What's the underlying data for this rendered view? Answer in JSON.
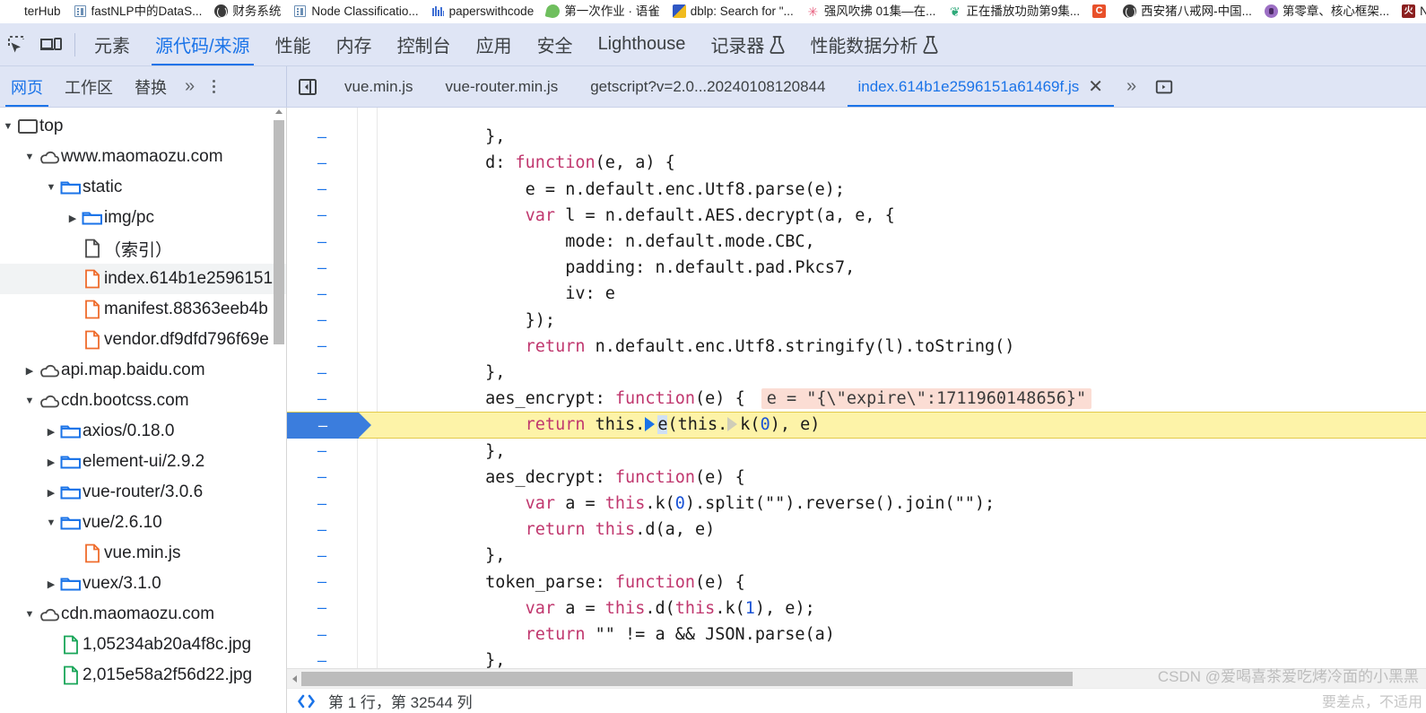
{
  "bookmarks": [
    {
      "label": "terHub",
      "icon": "generic-icon",
      "icon_class": "",
      "glyph": ""
    },
    {
      "label": "fastNLP中的DataS...",
      "icon": "document-icon",
      "icon_class": "fav-doc",
      "glyph": ""
    },
    {
      "label": "财务系统",
      "icon": "globe-icon",
      "icon_class": "fav-globe",
      "glyph": ""
    },
    {
      "label": "Node Classificatio...",
      "icon": "document-icon",
      "icon_class": "fav-doc",
      "glyph": ""
    },
    {
      "label": "paperswithcode",
      "icon": "chart-icon",
      "icon_class": "fav-chart",
      "glyph": ""
    },
    {
      "label": "第一次作业 · 语雀",
      "icon": "yuque-leaf-icon",
      "icon_class": "fav-leaf",
      "glyph": ""
    },
    {
      "label": "dblp: Search for \"...",
      "icon": "dblp-icon",
      "icon_class": "fav-dblp",
      "glyph": ""
    },
    {
      "label": "强风吹拂 01集—在...",
      "icon": "flower-icon",
      "icon_class": "fav-flower",
      "glyph": "✳"
    },
    {
      "label": "正在播放功勋第9集...",
      "icon": "green-video-icon",
      "icon_class": "fav-green-ic",
      "glyph": "❦"
    },
    {
      "label": "",
      "icon": "letter-c-icon",
      "icon_class": "fav-c",
      "glyph": "C"
    },
    {
      "label": "西安猪八戒网-中国...",
      "icon": "globe-icon",
      "icon_class": "fav-zhu",
      "glyph": ""
    },
    {
      "label": "第零章、核心框架...",
      "icon": "purple-circle-icon",
      "icon_class": "fav-purple",
      "glyph": ""
    },
    {
      "label": "Nginx学习 | 何吹",
      "icon": "nginx-icon",
      "icon_class": "fav-nginx",
      "glyph": "火"
    }
  ],
  "devtools": {
    "inspect_icon": "inspect-element-icon",
    "device_icon": "device-toolbar-icon",
    "tabs": [
      {
        "label": "元素",
        "active": false,
        "beaker": false
      },
      {
        "label": "源代码/来源",
        "active": true,
        "beaker": false
      },
      {
        "label": "性能",
        "active": false,
        "beaker": false
      },
      {
        "label": "内存",
        "active": false,
        "beaker": false
      },
      {
        "label": "控制台",
        "active": false,
        "beaker": false
      },
      {
        "label": "应用",
        "active": false,
        "beaker": false
      },
      {
        "label": "安全",
        "active": false,
        "beaker": false
      },
      {
        "label": "Lighthouse",
        "active": false,
        "beaker": false
      },
      {
        "label": "记录器",
        "active": false,
        "beaker": true
      },
      {
        "label": "性能数据分析",
        "active": false,
        "beaker": true
      }
    ]
  },
  "sources_toolbar": {
    "nav_tabs": [
      {
        "label": "网页",
        "active": true
      },
      {
        "label": "工作区",
        "active": false
      },
      {
        "label": "替换",
        "active": false
      }
    ],
    "more_chevron": "»",
    "kebab_name": "more-options-icon",
    "panel_toggle_icon": "collapse-navigator-icon",
    "file_tabs": [
      {
        "label": "vue.min.js",
        "active": false,
        "closable": false
      },
      {
        "label": "vue-router.min.js",
        "active": false,
        "closable": false
      },
      {
        "label": "getscript?v=2.0...20240108120844",
        "active": false,
        "closable": false
      },
      {
        "label": "index.614b1e2596151a61469f.js",
        "active": true,
        "closable": true
      }
    ],
    "close_glyph": "✕",
    "overflow_glyph": "»",
    "show_panel_icon": "show-drawer-icon"
  },
  "navigator": {
    "tree": [
      {
        "indent": 0,
        "twist": "▼",
        "icon": "frame-icon",
        "label": "top",
        "selected": false
      },
      {
        "indent": 1,
        "twist": "▼",
        "icon": "cloud-icon",
        "label": "www.maomaozu.com",
        "selected": false
      },
      {
        "indent": 2,
        "twist": "▼",
        "icon": "folder-icon",
        "label": "static",
        "selected": false
      },
      {
        "indent": 3,
        "twist": "▶",
        "icon": "folder-icon",
        "label": "img/pc",
        "selected": false
      },
      {
        "indent": 3,
        "twist": "",
        "icon": "document-icon",
        "label": "（索引）",
        "selected": false
      },
      {
        "indent": 3,
        "twist": "",
        "icon": "js-file-icon",
        "label": "index.614b1e2596151",
        "selected": true
      },
      {
        "indent": 3,
        "twist": "",
        "icon": "js-file-icon",
        "label": "manifest.88363eeb4b",
        "selected": false
      },
      {
        "indent": 3,
        "twist": "",
        "icon": "js-file-icon",
        "label": "vendor.df9dfd796f69e",
        "selected": false
      },
      {
        "indent": 1,
        "twist": "▶",
        "icon": "cloud-icon",
        "label": "api.map.baidu.com",
        "selected": false
      },
      {
        "indent": 1,
        "twist": "▼",
        "icon": "cloud-icon",
        "label": "cdn.bootcss.com",
        "selected": false
      },
      {
        "indent": 2,
        "twist": "▶",
        "icon": "folder-icon",
        "label": "axios/0.18.0",
        "selected": false
      },
      {
        "indent": 2,
        "twist": "▶",
        "icon": "folder-icon",
        "label": "element-ui/2.9.2",
        "selected": false
      },
      {
        "indent": 2,
        "twist": "▶",
        "icon": "folder-icon",
        "label": "vue-router/3.0.6",
        "selected": false
      },
      {
        "indent": 2,
        "twist": "▼",
        "icon": "folder-icon",
        "label": "vue/2.6.10",
        "selected": false
      },
      {
        "indent": 3,
        "twist": "",
        "icon": "js-file-icon",
        "label": "vue.min.js",
        "selected": false
      },
      {
        "indent": 2,
        "twist": "▶",
        "icon": "folder-icon",
        "label": "vuex/3.1.0",
        "selected": false
      },
      {
        "indent": 1,
        "twist": "▼",
        "icon": "cloud-icon",
        "label": "cdn.maomaozu.com",
        "selected": false
      },
      {
        "indent": 2,
        "twist": "",
        "icon": "image-file-icon",
        "label": "1,05234ab20a4f8c.jpg",
        "selected": false
      },
      {
        "indent": 2,
        "twist": "",
        "icon": "image-file-icon",
        "label": "2,015e58a2f56d22.jpg",
        "selected": false
      }
    ]
  },
  "editor": {
    "line_marker": "–",
    "lines": [
      {
        "marker": "",
        "text": "",
        "partial_top": true
      },
      {
        "marker": "–",
        "indent": 4,
        "segments": [
          {
            "t": "},"
          }
        ]
      },
      {
        "marker": "–",
        "indent": 4,
        "segments": [
          {
            "t": "d: "
          },
          {
            "t": "function",
            "c": "kw"
          },
          {
            "t": "(e, a) {"
          }
        ]
      },
      {
        "marker": "–",
        "indent": 6,
        "segments": [
          {
            "t": "e = n.default.enc.Utf8.parse(e);"
          }
        ]
      },
      {
        "marker": "–",
        "indent": 6,
        "segments": [
          {
            "t": "var",
            "c": "kw"
          },
          {
            "t": " l = n.default.AES.decrypt(a, e, {"
          }
        ]
      },
      {
        "marker": "–",
        "indent": 8,
        "segments": [
          {
            "t": "mode: n.default.mode.CBC,"
          }
        ]
      },
      {
        "marker": "–",
        "indent": 8,
        "segments": [
          {
            "t": "padding: n.default.pad.Pkcs7,"
          }
        ]
      },
      {
        "marker": "–",
        "indent": 8,
        "segments": [
          {
            "t": "iv: e"
          }
        ]
      },
      {
        "marker": "–",
        "indent": 6,
        "segments": [
          {
            "t": "});"
          }
        ]
      },
      {
        "marker": "–",
        "indent": 6,
        "segments": [
          {
            "t": "return",
            "c": "kw"
          },
          {
            "t": " n.default.enc.Utf8.stringify(l).toString()"
          }
        ]
      },
      {
        "marker": "–",
        "indent": 4,
        "segments": [
          {
            "t": "},"
          }
        ]
      },
      {
        "marker": "–",
        "indent": 4,
        "segments": [
          {
            "t": "aes_encrypt: "
          },
          {
            "t": "function",
            "c": "kw"
          },
          {
            "t": "(e) {"
          }
        ],
        "inline_value": "e = \"{\\\"expire\\\":1711960148656}\""
      },
      {
        "marker": "–",
        "indent": 6,
        "current": true,
        "segments": [
          {
            "t": "return",
            "c": "kw"
          },
          {
            "t": " this."
          },
          {
            "t": "▶",
            "c": "marker-filled"
          },
          {
            "t": "e",
            "c": "sel"
          },
          {
            "t": "(this."
          },
          {
            "t": "▷",
            "c": "marker-hollow"
          },
          {
            "t": "k("
          },
          {
            "t": "0",
            "c": "num"
          },
          {
            "t": "), e)"
          }
        ]
      },
      {
        "marker": "–",
        "indent": 4,
        "segments": [
          {
            "t": "},"
          }
        ]
      },
      {
        "marker": "–",
        "indent": 4,
        "segments": [
          {
            "t": "aes_decrypt: "
          },
          {
            "t": "function",
            "c": "kw"
          },
          {
            "t": "(e) {"
          }
        ]
      },
      {
        "marker": "–",
        "indent": 6,
        "segments": [
          {
            "t": "var",
            "c": "kw"
          },
          {
            "t": " a = "
          },
          {
            "t": "this",
            "c": "kw"
          },
          {
            "t": ".k("
          },
          {
            "t": "0",
            "c": "num"
          },
          {
            "t": ").split(\"\").reverse().join(\"\");"
          }
        ]
      },
      {
        "marker": "–",
        "indent": 6,
        "segments": [
          {
            "t": "return",
            "c": "kw"
          },
          {
            "t": " "
          },
          {
            "t": "this",
            "c": "kw"
          },
          {
            "t": ".d(a, e)"
          }
        ]
      },
      {
        "marker": "–",
        "indent": 4,
        "segments": [
          {
            "t": "},"
          }
        ]
      },
      {
        "marker": "–",
        "indent": 4,
        "segments": [
          {
            "t": "token_parse: "
          },
          {
            "t": "function",
            "c": "kw"
          },
          {
            "t": "(e) {"
          }
        ]
      },
      {
        "marker": "–",
        "indent": 6,
        "segments": [
          {
            "t": "var",
            "c": "kw"
          },
          {
            "t": " a = "
          },
          {
            "t": "this",
            "c": "kw"
          },
          {
            "t": ".d("
          },
          {
            "t": "this",
            "c": "kw"
          },
          {
            "t": ".k("
          },
          {
            "t": "1",
            "c": "num"
          },
          {
            "t": "), e);"
          }
        ]
      },
      {
        "marker": "–",
        "indent": 6,
        "segments": [
          {
            "t": "return",
            "c": "kw"
          },
          {
            "t": " \"\" != a && JSON.parse(a)"
          }
        ]
      },
      {
        "marker": "–",
        "indent": 4,
        "segments": [
          {
            "t": "},"
          }
        ]
      }
    ]
  },
  "statusbar": {
    "format_icon": "pretty-print-icon",
    "position_text": "第 1 行，第 32544 列"
  },
  "watermark": {
    "text": "CSDN @爱喝喜茶爱吃烤冷面的小黑黑",
    "text2": "要差点，不适用"
  },
  "colors": {
    "accent": "#1a73e8",
    "toolbar_bg": "#dfe5f5",
    "current_line": "#fdf3a8",
    "inline_value_bg": "#fbddd4",
    "keyword": "#c0376e",
    "number": "#1a53d6",
    "exec_arrow": "#3b7ddd"
  }
}
